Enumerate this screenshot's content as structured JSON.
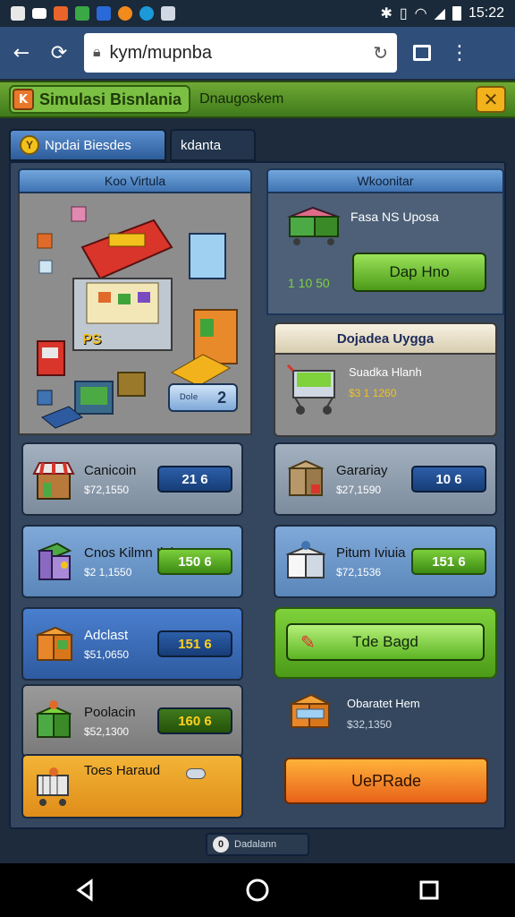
{
  "status_bar": {
    "time": "15:22",
    "icons": [
      "gallery-icon",
      "notification-icon",
      "app-icon",
      "app-icon",
      "app-icon",
      "app-icon",
      "app-icon",
      "app-icon"
    ],
    "right_icons": [
      "bluetooth-icon",
      "vibrate-icon",
      "wifi-icon",
      "signal-icon",
      "battery-icon"
    ]
  },
  "browser": {
    "url": "kym/mupnba",
    "back_icon": "back-arrow-icon",
    "refresh_icon": "refresh-icon",
    "tabs_icon": "tabs-icon",
    "menu_icon": "more-vert-icon"
  },
  "titlebar": {
    "logo": "K",
    "title": "Simulasi Bisnlania",
    "subtitle": "Dnaugoskem",
    "close": "✕"
  },
  "tabs": [
    {
      "label": "Npdai Biesdes",
      "active": true,
      "icon": "Y"
    },
    {
      "label": "kdanta",
      "active": false
    }
  ],
  "left_panel": {
    "header": "Koo Virtula",
    "store_badge": "PS",
    "store_button": {
      "small": "Dole",
      "value": "2"
    }
  },
  "right_panel": {
    "header": "Wkoonitar",
    "top_item": {
      "name": "Fasa NS Uposa",
      "price": "1 10 50",
      "button": "Dap Hno"
    },
    "featured": {
      "title": "Dojadea Uygga",
      "item_name": "Suadka Hlanh",
      "price": "$3 1 1260"
    }
  },
  "left_cards": [
    {
      "name": "Canicoin",
      "price": "$72,1550",
      "button": "21 6",
      "style": "gray",
      "btn": "blue"
    },
    {
      "name": "Cnos Kilmn Ilai",
      "price": "$2 1,1550",
      "button": "150 6",
      "style": "lblue",
      "btn": "green"
    },
    {
      "name": "Adclast",
      "price": "$51,0650",
      "button": "151 6",
      "style": "blue",
      "btn": "bluegold"
    },
    {
      "name": "Poolacin",
      "price": "$52,1300",
      "button": "160 6",
      "style": "gray2",
      "btn": "dkgreen"
    },
    {
      "name": "Toes Haraud",
      "price": "",
      "button": "",
      "style": "orange",
      "btn": ""
    }
  ],
  "right_cards": [
    {
      "name": "Garariay",
      "price": "$27,1590",
      "button": "10 6",
      "style": "gray",
      "btn": "blue"
    },
    {
      "name": "Pitum Iviuia",
      "price": "$72,1536",
      "button": "151 6",
      "style": "lblue",
      "btn": "green"
    }
  ],
  "right_actions": {
    "tde_button": "Tde Bagd",
    "last_item": {
      "name": "Obaratet Hem",
      "price": "$32,1350"
    },
    "upgrade_button": "UePRade"
  },
  "footer_chip": {
    "icon": "0",
    "label": "Dadalann"
  },
  "nav": [
    "back-triangle-icon",
    "home-circle-icon",
    "recents-square-icon"
  ]
}
